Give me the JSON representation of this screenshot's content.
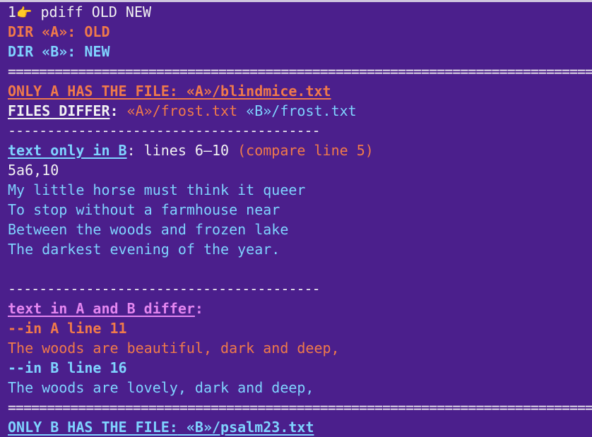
{
  "prompt": {
    "number": "1",
    "pointer_glyph": "👉",
    "command": " pdiff OLD NEW"
  },
  "dirs": {
    "a_label": "DIR «A»:",
    "a_value": " OLD",
    "b_label": "DIR «B»:",
    "b_value": " NEW"
  },
  "separators": {
    "double": "===========================================================================",
    "single": "----------------------------------------"
  },
  "only_a": {
    "label": "ONLY A HAS THE FILE:",
    "path": " «A»/blindmice.txt"
  },
  "files_differ": {
    "label": "FILES DIFFER",
    "colon": ": ",
    "path_a": "«A»/frost.txt",
    "space": " ",
    "path_b": "«B»/frost.txt"
  },
  "only_in_b": {
    "label": "text only in B",
    "colon": ": lines 6–10",
    "compare": " (compare line 5)",
    "diff_code": "5a6,10",
    "lines": [
      "My little horse must think it queer",
      "To stop without a farmhouse near",
      "Between the woods and frozen lake",
      "The darkest evening of the year."
    ]
  },
  "differ": {
    "label": "text in A and B differ",
    "colon": ":",
    "in_a_header": "--in A line 11",
    "in_a_text": "The woods are beautiful, dark and deep,",
    "in_b_header": "--in B line 16",
    "in_b_text": "The woods are lovely, dark and deep,"
  },
  "only_b": {
    "label": "ONLY B HAS THE FILE:",
    "path": " «B»/psalm23.txt"
  },
  "colors": {
    "background": "#4b1f8c",
    "white": "#f2f2f2",
    "orange": "#f07a4a",
    "cyan": "#7fd3ff",
    "pink": "#e486f0"
  }
}
